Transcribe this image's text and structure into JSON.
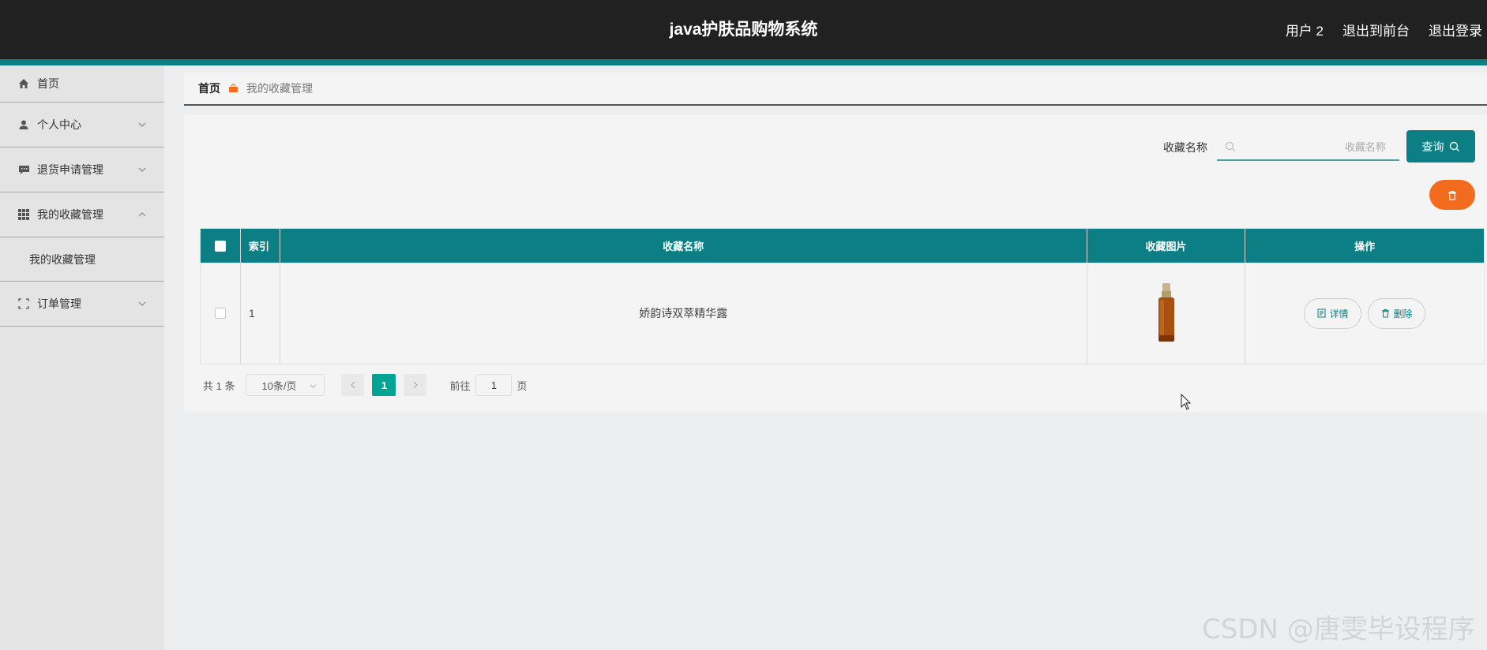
{
  "header": {
    "app_title": "java护肤品购物系统",
    "user": "用户 2",
    "back_front": "退出到前台",
    "logout": "退出登录"
  },
  "sidebar": {
    "items": [
      {
        "label": "首页",
        "icon": "home-icon"
      },
      {
        "label": "个人中心",
        "icon": "user-icon"
      },
      {
        "label": "退货申请管理",
        "icon": "chat-icon"
      },
      {
        "label": "我的收藏管理",
        "icon": "grid-icon",
        "expanded": true
      },
      {
        "label": "订单管理",
        "icon": "frame-icon"
      }
    ],
    "sub_items": [
      "我的收藏管理"
    ]
  },
  "breadcrumb": {
    "home": "首页",
    "current": "我的收藏管理"
  },
  "search": {
    "label": "收藏名称",
    "placeholder": "收藏名称",
    "value": "",
    "query_button": "查询"
  },
  "table": {
    "columns": [
      "索引",
      "收藏名称",
      "收藏图片",
      "操作"
    ],
    "rows": [
      {
        "index": "1",
        "name": "娇韵诗双萃精华露",
        "image": "serum-bottle-image"
      }
    ],
    "actions": {
      "detail": "详情",
      "delete": "删除"
    }
  },
  "pagination": {
    "total_text": "共 1 条",
    "page_size": "10条/页",
    "current_page": "1",
    "goto_label": "前往",
    "goto_value": "1",
    "page_suffix": "页"
  },
  "watermark": "CSDN @唐雯毕设程序",
  "colors": {
    "primary": "#0b7f84",
    "danger": "#f36b1d",
    "page_active": "#00a495",
    "topbar": "#212121"
  }
}
